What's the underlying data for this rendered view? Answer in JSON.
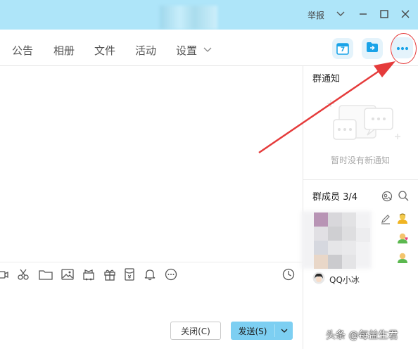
{
  "titlebar": {
    "report_label": "举报",
    "icons": [
      "chevron-down-icon",
      "minimize-icon",
      "maximize-icon",
      "close-icon"
    ]
  },
  "tabs": [
    {
      "label": "公告"
    },
    {
      "label": "相册"
    },
    {
      "label": "文件"
    },
    {
      "label": "活动"
    },
    {
      "label": "设置"
    }
  ],
  "tab_tools": {
    "calendar_day": "7",
    "icons": [
      "calendar-icon",
      "share-screen-icon",
      "more-icon"
    ]
  },
  "composer": {
    "toolbar_icons": [
      "video-icon",
      "scissors-icon",
      "folder-icon",
      "image-icon",
      "gift-box-icon",
      "gift-icon",
      "red-packet-icon",
      "bell-icon",
      "more-circle-icon",
      "history-clock-icon"
    ],
    "close_label": "关闭(C)",
    "send_label": "发送(S)"
  },
  "notice": {
    "title": "群通知",
    "empty_text": "暂时没有新通知"
  },
  "members": {
    "title": "群成员 3/4",
    "bot_name": "QQ小冰"
  },
  "watermark": "头条 @每益生君",
  "colors": {
    "titlebar": "#aee5f9",
    "accent": "#1aa3e8",
    "send_button": "#7dcff2",
    "annotation_red": "#e53b3b"
  }
}
